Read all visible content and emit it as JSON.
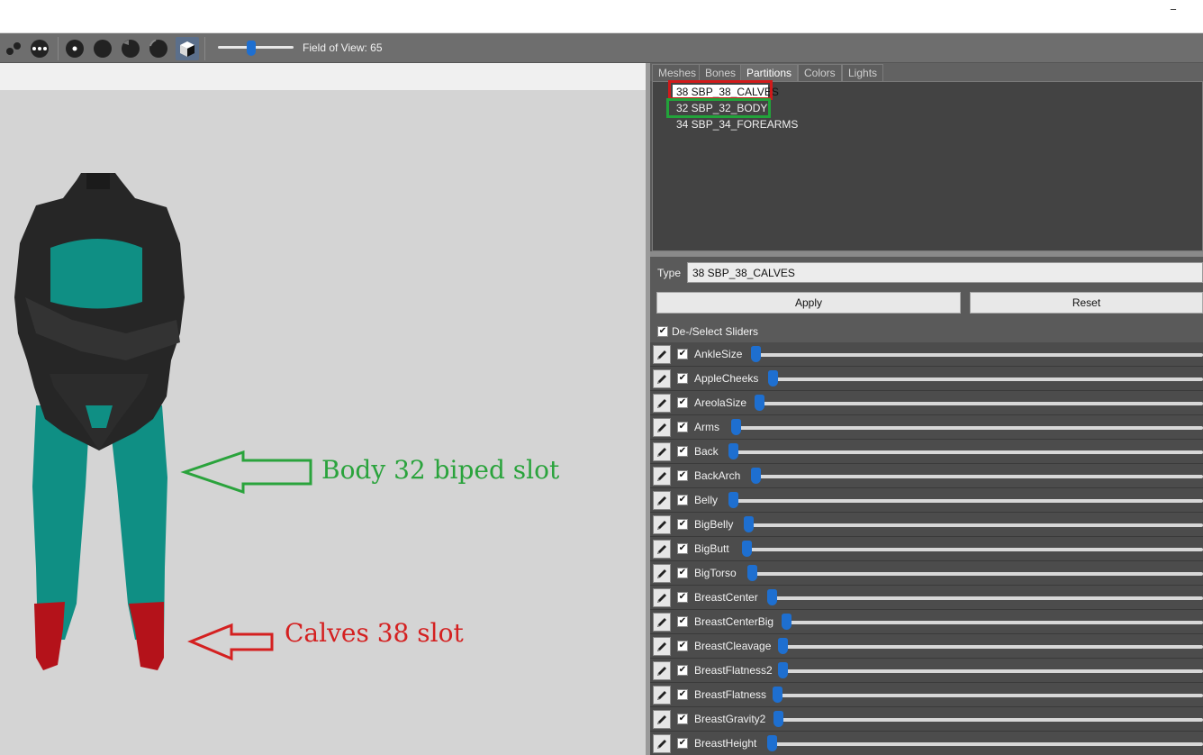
{
  "window": {
    "minimize_glyph": "_"
  },
  "toolbar": {
    "buttons": [
      {
        "icon": "two-dots-diagonal-icon"
      },
      {
        "icon": "three-dots-icon"
      },
      {
        "icon": "small-dot-icon"
      },
      {
        "icon": "sphere-icon"
      },
      {
        "icon": "half-sphere-icon"
      },
      {
        "icon": "shaded-sphere-icon"
      },
      {
        "icon": "cube-icon"
      }
    ],
    "fov_label": "Field of View: 65",
    "fov_value": 65
  },
  "annotations": {
    "body": {
      "text": "Body 32 biped slot",
      "color": "#2aa33c"
    },
    "calves": {
      "text": "Calves 38 slot",
      "color": "#d42020"
    }
  },
  "tabs": [
    {
      "label": "Meshes"
    },
    {
      "label": "Bones"
    },
    {
      "label": "Partitions"
    },
    {
      "label": "Colors"
    },
    {
      "label": "Lights"
    }
  ],
  "partitions": [
    {
      "label": "38 SBP_38_CALVES"
    },
    {
      "label": "32 SBP_32_BODY"
    },
    {
      "label": "34 SBP_34_FOREARMS"
    }
  ],
  "type": {
    "label": "Type",
    "value": "38 SBP_38_CALVES"
  },
  "buttons": {
    "apply": "Apply",
    "reset": "Reset"
  },
  "deselect": {
    "label": "De-/Select Sliders",
    "checked": true
  },
  "sliders": [
    {
      "name": "AnkleSize",
      "value": 0.0
    },
    {
      "name": "AppleCheeks",
      "value": 0.0
    },
    {
      "name": "AreolaSize",
      "value": 0.0
    },
    {
      "name": "Arms",
      "value": 0.0
    },
    {
      "name": "Back",
      "value": 0.0
    },
    {
      "name": "BackArch",
      "value": 0.0
    },
    {
      "name": "Belly",
      "value": 0.0
    },
    {
      "name": "BigBelly",
      "value": 0.0
    },
    {
      "name": "BigButt",
      "value": 0.0
    },
    {
      "name": "BigTorso",
      "value": 0.0
    },
    {
      "name": "BreastCenter",
      "value": 0.0
    },
    {
      "name": "BreastCenterBig",
      "value": 0.0
    },
    {
      "name": "BreastCleavage",
      "value": 0.0
    },
    {
      "name": "BreastFlatness2",
      "value": 0.0
    },
    {
      "name": "BreastFlatness",
      "value": 0.0
    },
    {
      "name": "BreastGravity2",
      "value": 0.0
    },
    {
      "name": "BreastHeight",
      "value": 0.0
    }
  ]
}
